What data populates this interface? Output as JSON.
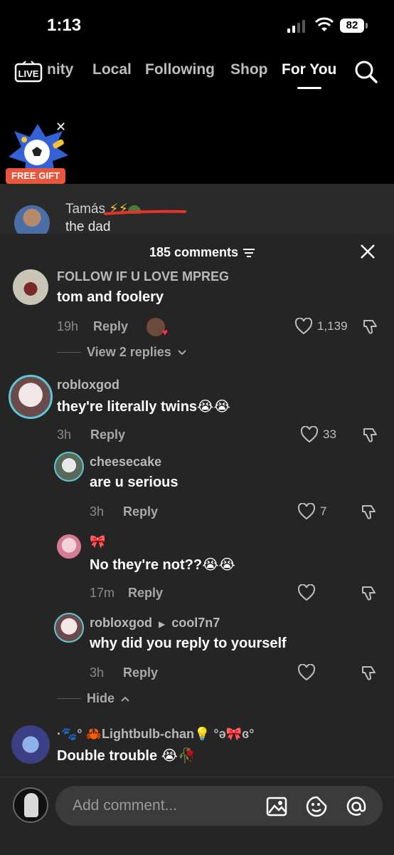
{
  "status": {
    "time": "1:13",
    "battery": "82"
  },
  "nav": {
    "live_label": "LIVE",
    "items": [
      "nity",
      "Local",
      "Following",
      "Shop",
      "For You"
    ],
    "active": "For You"
  },
  "gift": {
    "label": "FREE GIFT"
  },
  "live_comment": {
    "name": "Tamás",
    "text": "the dad"
  },
  "sheet": {
    "count_label": "185 comments"
  },
  "comments": [
    {
      "username": "FOLLOW IF U LOVE MPREG",
      "text": "tom and foolery",
      "age": "19h",
      "reply": "Reply",
      "likes": "1,139",
      "view_replies": "View 2 replies"
    },
    {
      "username": "robloxgod",
      "text": "they're literally twins😭😭",
      "age": "3h",
      "reply": "Reply",
      "likes": "33"
    },
    {
      "username": "cheesecake",
      "text": "are u serious",
      "age": "3h",
      "reply": "Reply",
      "likes": "7"
    },
    {
      "username": "🎀",
      "text": "No they're not??😭😭",
      "age": "17m",
      "reply": "Reply",
      "likes": ""
    },
    {
      "username": "robloxgod",
      "reply_to": "cool7n7",
      "text": "why did you reply to yourself",
      "age": "3h",
      "reply": "Reply",
      "likes": "",
      "hide": "Hide"
    },
    {
      "username": "·🐾° 🦀Lightbulb-chan💡 °ə🎀ɞ°",
      "text": "Double trouble 😭🥀"
    }
  ],
  "composer": {
    "placeholder": "Add comment..."
  },
  "colors": {
    "background": "#000000",
    "sheet": "#252525",
    "accent": "#e8563c"
  }
}
